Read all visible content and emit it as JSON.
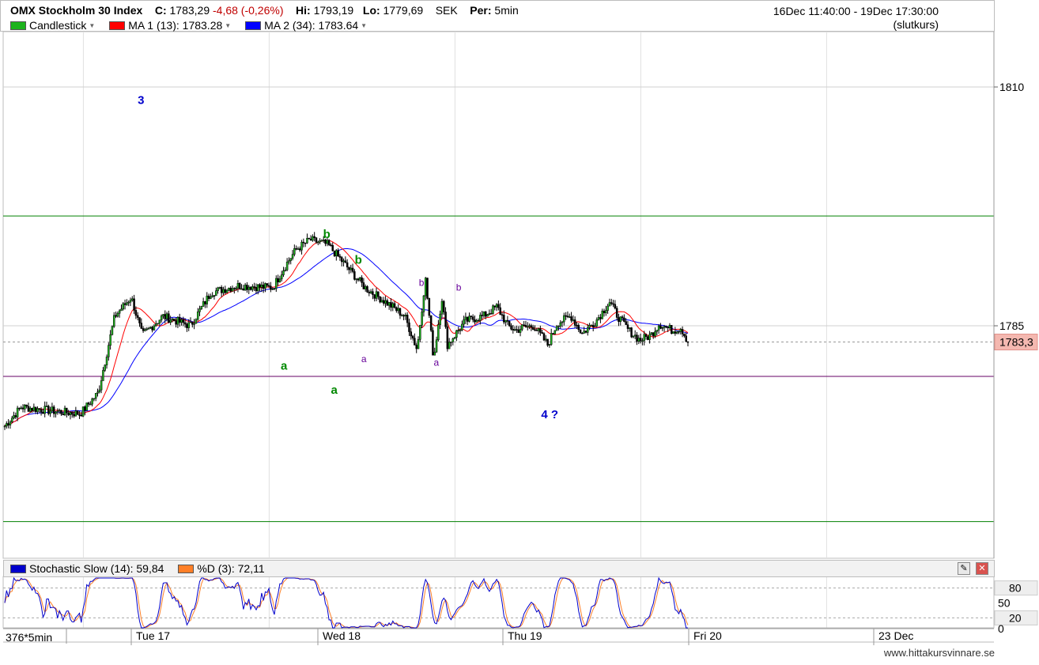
{
  "header": {
    "title": "OMX Stockholm 30 Index",
    "close_label": "C:",
    "close_value": "1783,29",
    "change": "-4,68 (-0,26%)",
    "hi_label": "Hi:",
    "hi_value": "1793,19",
    "lo_label": "Lo:",
    "lo_value": "1779,69",
    "currency": "SEK",
    "period_label": "Per:",
    "period_value": "5min",
    "date_range": "16Dec 11:40:00 - 19Dec 17:30:00",
    "price_mode": "(slutkurs)"
  },
  "legend": {
    "candlestick": {
      "label": "Candlestick",
      "color": "#1db31d"
    },
    "ma1": {
      "label": "MA 1 (13): 1783.28",
      "color": "#ff0000"
    },
    "ma2": {
      "label": "MA 2 (34): 1783.64",
      "color": "#0000ff"
    }
  },
  "stochastic": {
    "slow": {
      "label": "Stochastic Slow (14): 59,84",
      "color": "#0000cc"
    },
    "d": {
      "label": "%D (3): 72,11",
      "color": "#ff7f27"
    },
    "levels": [
      "80",
      "50",
      "20"
    ],
    "bottom_label": "0"
  },
  "x_axis": {
    "bar_count": "376*5min",
    "days": [
      "Tue 17",
      "Wed 18",
      "Thu 19",
      "Fri 20",
      "23 Dec"
    ]
  },
  "watermark": "www.hittakursvinnare.se",
  "chart_data": {
    "type": "candlestick",
    "y_ticks": [
      1810,
      1785
    ],
    "y_range": [
      1750,
      1818
    ],
    "last_price_label": "1783,3",
    "horizontal_lines": [
      {
        "value": 1796.5,
        "color": "#008000"
      },
      {
        "value": 1779.7,
        "color": "#660066"
      },
      {
        "value": 1764.5,
        "color": "#008000"
      }
    ],
    "wave_labels": [
      {
        "text": "3",
        "color": "#0000cc",
        "x_day": 1.05,
        "y": 1808.2
      },
      {
        "text": "b",
        "color": "#008800",
        "x_day": 2.05,
        "y": 1794.2
      },
      {
        "text": "b",
        "color": "#008800",
        "x_day": 2.22,
        "y": 1791.5
      },
      {
        "text": "a",
        "color": "#008800",
        "x_day": 1.82,
        "y": 1780.4
      },
      {
        "text": "a",
        "color": "#008800",
        "x_day": 2.09,
        "y": 1777.9
      },
      {
        "text": "b",
        "color": "#660099",
        "x_day": 2.56,
        "y": 1789.2
      },
      {
        "text": "b",
        "color": "#660099",
        "x_day": 2.76,
        "y": 1788.7
      },
      {
        "text": "a",
        "color": "#660099",
        "x_day": 2.25,
        "y": 1781.2
      },
      {
        "text": "a",
        "color": "#660099",
        "x_day": 2.64,
        "y": 1780.8
      },
      {
        "text": "4 ?",
        "color": "#0000cc",
        "x_day": 3.25,
        "y": 1775.3
      }
    ],
    "stoch_range": [
      0,
      100
    ]
  }
}
